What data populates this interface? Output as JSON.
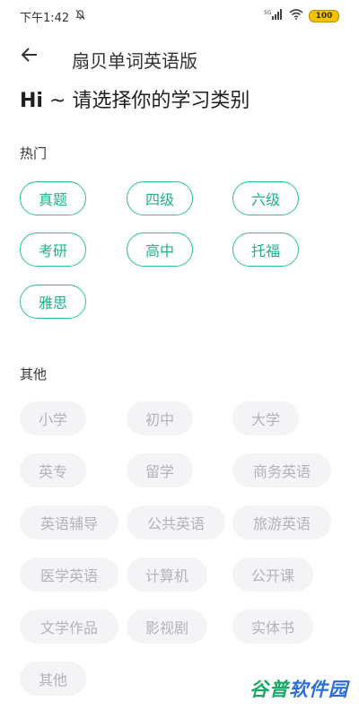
{
  "status_bar": {
    "time": "下午1:42",
    "mute_icon": "bell-off-icon",
    "signal_label": "5G",
    "battery": "100",
    "battery_color": "#f2c200"
  },
  "header": {
    "back_icon": "arrow-left-icon",
    "title": "扇贝单词英语版"
  },
  "headline": {
    "hi": "Hi",
    "text": " ~ 请选择你的学习类别"
  },
  "sections": {
    "hot": {
      "label": "热门",
      "items": [
        "真题",
        "四级",
        "六级",
        "考研",
        "高中",
        "托福",
        "雅思"
      ]
    },
    "other": {
      "label": "其他",
      "items": [
        "小学",
        "初中",
        "大学",
        "英专",
        "留学",
        "商务英语",
        "英语辅导",
        "公共英语",
        "旅游英语",
        "医学英语",
        "计算机",
        "公开课",
        "文学作品",
        "影视剧",
        "实体书",
        "其他"
      ]
    }
  },
  "colors": {
    "accent": "#21b18b",
    "chip_muted_bg": "#f4f4f6",
    "chip_muted_text": "#b3b3b8"
  },
  "watermark": {
    "part1": "谷普",
    "part2": "软件园"
  }
}
